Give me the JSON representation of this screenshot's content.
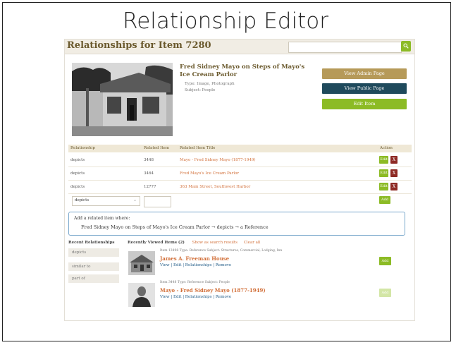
{
  "slide": {
    "title": "Relationship Editor"
  },
  "header": {
    "title": "Relationships for Item 7280",
    "search_placeholder": ""
  },
  "item": {
    "title": "Fred Sidney Mayo on Steps of Mayo's Ice Cream Parlor",
    "type_line": "Type: Image, Photograph",
    "subject_line": "Subject: People"
  },
  "actions": {
    "view_admin": "View Admin Page",
    "view_public": "View Public Page",
    "edit_item": "Edit Item"
  },
  "table": {
    "headers": {
      "relationship": "Relationship",
      "related_item": "Related Item",
      "title": "Related Item Title",
      "action": "Action"
    },
    "rows": [
      {
        "relationship": "depicts",
        "id": "3448",
        "title": "Mayo - Fred Sidney Mayo (1877-1949)"
      },
      {
        "relationship": "depicts",
        "id": "3464",
        "title": "Fred Mayo's Ice Cream Parlor"
      },
      {
        "relationship": "depicts",
        "id": "12777",
        "title": "363 Main Street, Southwest Harbor"
      }
    ],
    "edit_label": "Edit",
    "remove_label": "X",
    "new_row": {
      "selected": "depicts",
      "id_value": "",
      "add_label": "Add"
    }
  },
  "hint": {
    "label": "Add a related item where:",
    "subject": "Fred Sidney Mayo on Steps of Mayo's Ice Cream Parlor",
    "arrow1": "→",
    "relation": "depicts",
    "arrow2": "→",
    "object": "a Reference"
  },
  "recent_relationships": {
    "label": "Recent Relationships",
    "items": [
      "depicts",
      "similar to",
      "part of"
    ]
  },
  "recently_viewed": {
    "label": "Recently Viewed Items (2)",
    "show_results": "Show as search results",
    "clear": "Clear all",
    "items": [
      {
        "meta": "Item 13498  Type: Reference  Subject: Structures, Commercial, Lodging, Inn",
        "name": "James A. Freeman House",
        "links": "View | Edit | Relationships | Remove",
        "add_label": "Add"
      },
      {
        "meta": "Item 3448  Type: Reference  Subject: People",
        "name": "Mayo - Fred Sidney Mayo (1877-1949)",
        "links": "View | Edit | Relationships | Remove",
        "add_label": "Add"
      }
    ]
  },
  "colors": {
    "accent_green": "#8cbb25",
    "gold": "#b69a59",
    "navy": "#1f4a5c",
    "link_orange": "#d2703a",
    "remove_red": "#8e2a24"
  }
}
